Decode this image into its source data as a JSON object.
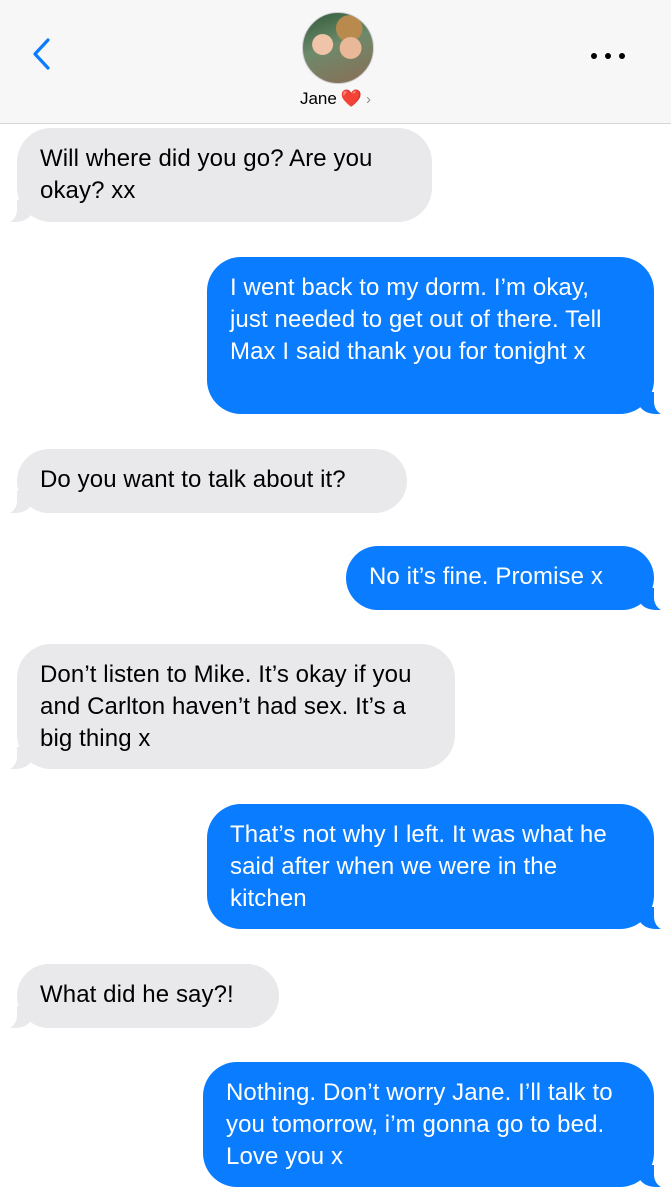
{
  "header": {
    "back_icon": "chevron-left-icon",
    "contact_name": "Jane",
    "heart": "❤️",
    "chevron": "›",
    "more_icon": "ellipsis-icon",
    "accent": "#0a7cff"
  },
  "messages": [
    {
      "direction": "incoming",
      "text": "Will where did you go? Are you okay? xx"
    },
    {
      "direction": "outgoing",
      "text": "I went back to my dorm. I’m okay, just needed to get out of there. Tell Max I said thank you for tonight x"
    },
    {
      "direction": "incoming",
      "text": "Do you want to talk about it?"
    },
    {
      "direction": "outgoing",
      "text": "No it’s fine. Promise x"
    },
    {
      "direction": "incoming",
      "text": "Don’t listen to Mike. It’s okay if you and Carlton haven’t had sex. It’s a big thing x"
    },
    {
      "direction": "outgoing",
      "text": "That’s not why I left. It was what he said after when we were in the kitchen"
    },
    {
      "direction": "incoming",
      "text": "What did he say?!"
    },
    {
      "direction": "outgoing",
      "text": "Nothing. Don’t worry Jane. I’ll talk to you tomorrow, i’m gonna go to bed. Love you x"
    }
  ]
}
